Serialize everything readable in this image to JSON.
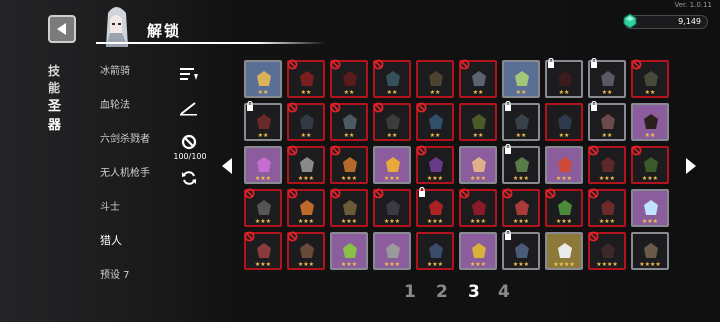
{
  "version": "Ver. 1.0.11",
  "header": {
    "title": "解锁"
  },
  "currency": {
    "amount": "9,149",
    "icon": "gem-icon",
    "color": "#2fd3a0"
  },
  "tabs": [
    {
      "label": "技能",
      "active": false
    },
    {
      "label": "圣器",
      "active": true
    }
  ],
  "categories": [
    {
      "label": "冰箭骑",
      "active": false
    },
    {
      "label": "血轮法",
      "active": false
    },
    {
      "label": "六剑杀戮者",
      "active": false
    },
    {
      "label": "无人机枪手",
      "active": false
    },
    {
      "label": "斗士",
      "active": false
    },
    {
      "label": "猎人",
      "active": true
    },
    {
      "label": "预设 7",
      "active": false
    }
  ],
  "tools": {
    "sort_icon": "sort-icon",
    "filter_icon": "slope-icon",
    "disable_icon": "ban-icon",
    "capacity": "100/100",
    "refresh_icon": "refresh-icon"
  },
  "colors": {
    "locked_border": "#b3131c",
    "owned_border": "#8a8a92",
    "star": "#f3c24a",
    "blue_bg": "#5a6f95",
    "purple_bg": "#8b5d9c",
    "gold_bg": "#8d7a3a"
  },
  "grid": {
    "rows": [
      [
        {
          "stars": "★★",
          "state": "owned",
          "bg": "blue",
          "mark": "none",
          "art": "#d8b35a"
        },
        {
          "stars": "★★",
          "state": "locked",
          "bg": "dark",
          "mark": "ban",
          "art": "#7a1f1f"
        },
        {
          "stars": "★★",
          "state": "locked",
          "bg": "dark",
          "mark": "ban",
          "art": "#5a1a1a"
        },
        {
          "stars": "★★",
          "state": "locked",
          "bg": "dark",
          "mark": "ban",
          "art": "#36505a"
        },
        {
          "stars": "★★",
          "state": "locked",
          "bg": "dark",
          "mark": "none",
          "art": "#4c4232"
        },
        {
          "stars": "★★",
          "state": "locked",
          "bg": "dark",
          "mark": "ban",
          "art": "#5a6470"
        },
        {
          "stars": "★★",
          "state": "owned",
          "bg": "blue",
          "mark": "none",
          "art": "#a3c77a"
        },
        {
          "stars": "★★",
          "state": "owned",
          "bg": "dark",
          "mark": "lock",
          "art": "#3a1c1c"
        },
        {
          "stars": "★★",
          "state": "owned",
          "bg": "dark",
          "mark": "lock",
          "art": "#5a5a64"
        },
        {
          "stars": "★★",
          "state": "locked",
          "bg": "dark",
          "mark": "ban",
          "art": "#4a4a3a"
        }
      ],
      [
        {
          "stars": "★★",
          "state": "owned",
          "bg": "dark",
          "mark": "lock",
          "art": "#6a2a2a"
        },
        {
          "stars": "★★",
          "state": "locked",
          "bg": "dark",
          "mark": "ban",
          "art": "#333a44"
        },
        {
          "stars": "★★",
          "state": "locked",
          "bg": "dark",
          "mark": "ban",
          "art": "#4c5a66"
        },
        {
          "stars": "★★",
          "state": "locked",
          "bg": "dark",
          "mark": "ban",
          "art": "#3c3c3c"
        },
        {
          "stars": "★★",
          "state": "locked",
          "bg": "dark",
          "mark": "ban",
          "art": "#2f4f6a"
        },
        {
          "stars": "★★",
          "state": "locked",
          "bg": "dark",
          "mark": "none",
          "art": "#4c5a2a"
        },
        {
          "stars": "★★",
          "state": "owned",
          "bg": "dark",
          "mark": "lock",
          "art": "#39424a"
        },
        {
          "stars": "★★",
          "state": "locked",
          "bg": "dark",
          "mark": "none",
          "art": "#2e3a4e"
        },
        {
          "stars": "★★",
          "state": "owned",
          "bg": "dark",
          "mark": "lock",
          "art": "#6a4a4a"
        },
        {
          "stars": "★★",
          "state": "owned",
          "bg": "purple",
          "mark": "none",
          "art": "#2a2020"
        }
      ],
      [
        {
          "stars": "★★★",
          "state": "owned",
          "bg": "purple",
          "mark": "none",
          "art": "#c56ed0"
        },
        {
          "stars": "★★★",
          "state": "locked",
          "bg": "dark",
          "mark": "ban",
          "art": "#8a8a8a"
        },
        {
          "stars": "★★★",
          "state": "locked",
          "bg": "dark",
          "mark": "ban",
          "art": "#b26b2a"
        },
        {
          "stars": "★★★",
          "state": "owned",
          "bg": "purple",
          "mark": "none",
          "art": "#e6a93a"
        },
        {
          "stars": "★★★",
          "state": "locked",
          "bg": "dark",
          "mark": "ban",
          "art": "#6a3a8a"
        },
        {
          "stars": "★★★",
          "state": "owned",
          "bg": "purple",
          "mark": "none",
          "art": "#e0b08a"
        },
        {
          "stars": "★★★",
          "state": "owned",
          "bg": "dark",
          "mark": "lock",
          "art": "#5a7a4a"
        },
        {
          "stars": "★★★",
          "state": "owned",
          "bg": "purple",
          "mark": "none",
          "art": "#d04a3a"
        },
        {
          "stars": "★★★",
          "state": "locked",
          "bg": "dark",
          "mark": "ban",
          "art": "#5a2a2a"
        },
        {
          "stars": "★★★",
          "state": "locked",
          "bg": "dark",
          "mark": "ban",
          "art": "#3a5a2a"
        }
      ],
      [
        {
          "stars": "★★★",
          "state": "locked",
          "bg": "dark",
          "mark": "ban",
          "art": "#555555"
        },
        {
          "stars": "★★★",
          "state": "locked",
          "bg": "dark",
          "mark": "ban",
          "art": "#c06a2a"
        },
        {
          "stars": "★★★",
          "state": "locked",
          "bg": "dark",
          "mark": "ban",
          "art": "#6a5a3a"
        },
        {
          "stars": "★★★",
          "state": "locked",
          "bg": "dark",
          "mark": "ban",
          "art": "#3a3a44"
        },
        {
          "stars": "★★★",
          "state": "locked",
          "bg": "dark",
          "mark": "lock",
          "art": "#aa2222"
        },
        {
          "stars": "★★★",
          "state": "locked",
          "bg": "dark",
          "mark": "ban",
          "art": "#8a1a2a"
        },
        {
          "stars": "★★★",
          "state": "locked",
          "bg": "dark",
          "mark": "ban",
          "art": "#aa3a3a"
        },
        {
          "stars": "★★★",
          "state": "locked",
          "bg": "dark",
          "mark": "ban",
          "art": "#4a8a3a"
        },
        {
          "stars": "★★★",
          "state": "locked",
          "bg": "dark",
          "mark": "ban",
          "art": "#6a2a2a"
        },
        {
          "stars": "★★★",
          "state": "owned",
          "bg": "purple",
          "mark": "none",
          "art": "#bfe4ff"
        }
      ],
      [
        {
          "stars": "★★★",
          "state": "locked",
          "bg": "dark",
          "mark": "ban",
          "art": "#8a3a3a"
        },
        {
          "stars": "★★★",
          "state": "locked",
          "bg": "dark",
          "mark": "ban",
          "art": "#6a4a3a"
        },
        {
          "stars": "★★★",
          "state": "owned",
          "bg": "purple",
          "mark": "none",
          "art": "#8ac04a"
        },
        {
          "stars": "★★★",
          "state": "owned",
          "bg": "purple",
          "mark": "none",
          "art": "#9a9a9a"
        },
        {
          "stars": "★★★",
          "state": "locked",
          "bg": "dark",
          "mark": "none",
          "art": "#3a4a6a"
        },
        {
          "stars": "★★★",
          "state": "owned",
          "bg": "purple",
          "mark": "none",
          "art": "#d8b03a"
        },
        {
          "stars": "★★★",
          "state": "owned",
          "bg": "dark",
          "mark": "lock",
          "art": "#4a5a7a"
        },
        {
          "stars": "★★★★",
          "state": "owned",
          "bg": "gold",
          "mark": "none",
          "art": "#eaeaea"
        },
        {
          "stars": "★★★★",
          "state": "locked",
          "bg": "dark",
          "mark": "ban",
          "art": "#3a2a2a"
        },
        {
          "stars": "★★★★",
          "state": "owned",
          "bg": "dark",
          "mark": "none",
          "art": "#6a5a4a"
        }
      ]
    ]
  },
  "pager": {
    "pages": [
      "1",
      "2",
      "3",
      "4"
    ],
    "active_index": 2
  },
  "nav": {
    "left_arrow": "arrow-left-icon",
    "right_arrow": "arrow-right-icon"
  }
}
